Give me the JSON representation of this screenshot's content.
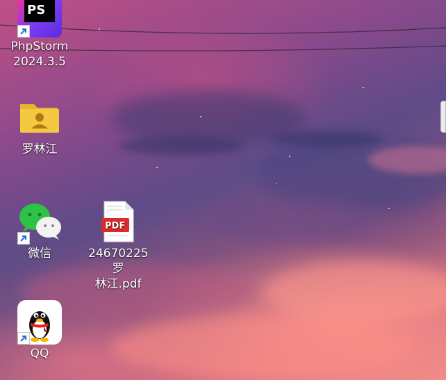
{
  "desktop": {
    "icons": [
      {
        "label_line1": "PhpStorm",
        "label_line2": "2024.3.5",
        "icon": "phpstorm-icon",
        "logo_text": "PS",
        "shortcut": true
      },
      {
        "label_line1": "罗林江",
        "label_line2": "",
        "icon": "user-folder-icon",
        "shortcut": false
      },
      {
        "label_line1": "微信",
        "label_line2": "",
        "icon": "wechat-icon",
        "shortcut": true
      },
      {
        "label_line1": "24670225罗",
        "label_line2": "林江.pdf",
        "icon": "pdf-file-icon",
        "badge_text": "PDF",
        "shortcut": false
      },
      {
        "label_line1": "QQ",
        "label_line2": "",
        "icon": "qq-penguin-icon",
        "shortcut": true
      }
    ]
  },
  "colors": {
    "pdf_red": "#e02a2a",
    "folder_yellow": "#f5c842",
    "wechat_green": "#2ec247",
    "phpstorm_purple": "#7b3cf0",
    "phpstorm_pink": "#ff318c"
  }
}
